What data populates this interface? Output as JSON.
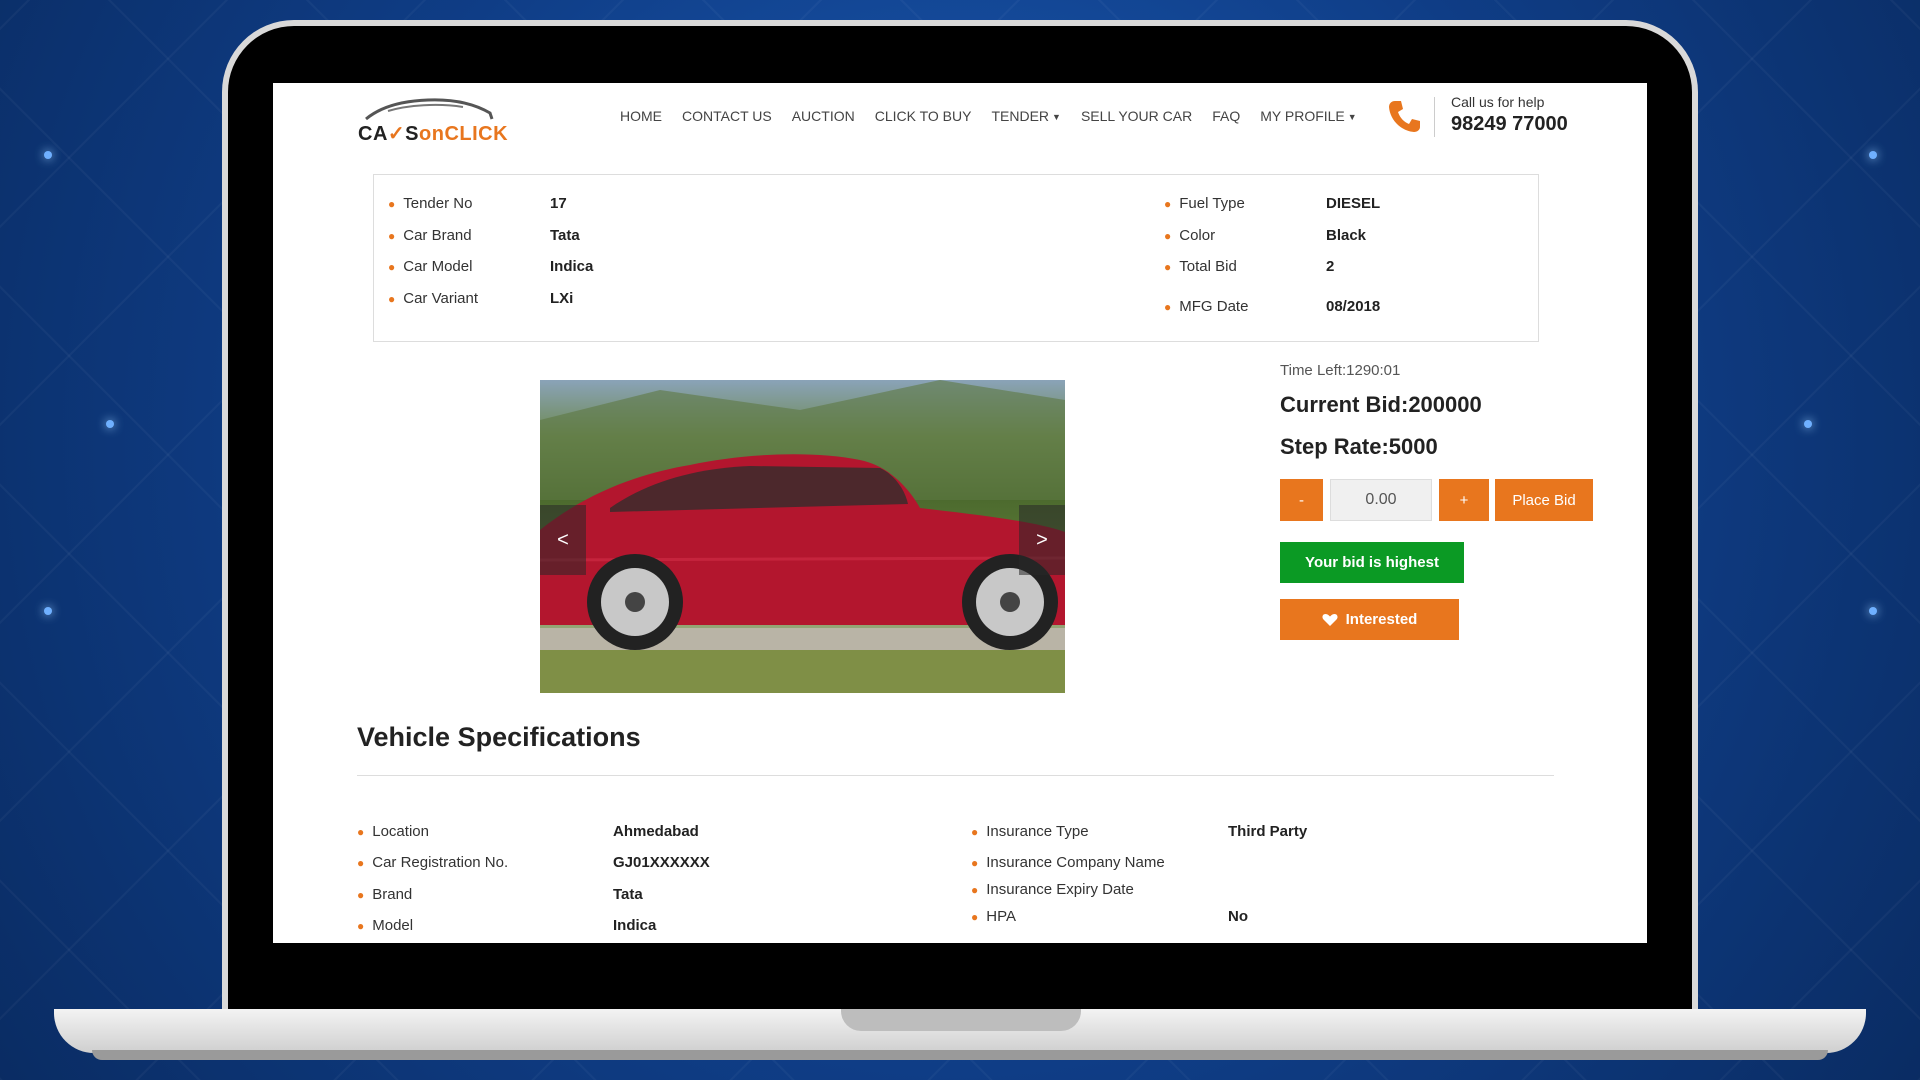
{
  "brand": {
    "logo_part1": "CA",
    "logo_part1b": "S",
    "logo_part2": "on",
    "logo_part3": "CLICK"
  },
  "nav": [
    {
      "label": "HOME",
      "dropdown": false
    },
    {
      "label": "CONTACT US",
      "dropdown": false
    },
    {
      "label": "AUCTION",
      "dropdown": false
    },
    {
      "label": "CLICK TO BUY",
      "dropdown": false
    },
    {
      "label": "TENDER",
      "dropdown": true
    },
    {
      "label": "SELL YOUR CAR",
      "dropdown": false
    },
    {
      "label": "FAQ",
      "dropdown": false
    },
    {
      "label": "MY PROFILE",
      "dropdown": true
    }
  ],
  "help": {
    "label": "Call us for help",
    "phone": "98249 77000"
  },
  "tender": {
    "left": [
      {
        "label": "Tender No",
        "value": "17"
      },
      {
        "label": "Car Brand",
        "value": "Tata"
      },
      {
        "label": "Car Model",
        "value": "Indica"
      },
      {
        "label": "Car Variant",
        "value": "LXi"
      }
    ],
    "right": [
      {
        "label": "Fuel Type",
        "value": "DIESEL"
      },
      {
        "label": "Color",
        "value": "Black"
      },
      {
        "label": "Total Bid",
        "value": "2"
      },
      {
        "label": "MFG Date",
        "value": "08/2018"
      }
    ]
  },
  "carousel": {
    "prev_label": "<",
    "next_label": ">"
  },
  "bid": {
    "time_left": "Time Left:1290:01",
    "current_bid": "Current Bid:200000",
    "step_rate": "Step Rate:5000",
    "minus_label": "-",
    "plus_label": "+",
    "input_value": "0.00",
    "place_bid_label": "Place Bid",
    "status_label": "Your bid is highest",
    "interested_label": "Interested"
  },
  "specs": {
    "title": "Vehicle Specifications",
    "left": [
      {
        "label": "Location",
        "value": "Ahmedabad"
      },
      {
        "label": "Car Registration No.",
        "value": "GJ01XXXXXX"
      },
      {
        "label": "Brand",
        "value": "Tata"
      },
      {
        "label": "Model",
        "value": "Indica"
      }
    ],
    "right": [
      {
        "label": "Insurance Type",
        "value": "Third Party"
      },
      {
        "label": "Insurance Company Name",
        "value": ""
      },
      {
        "label": "Insurance Expiry Date",
        "value": ""
      },
      {
        "label": "HPA",
        "value": "No"
      }
    ]
  },
  "colors": {
    "accent": "#e8761e",
    "success": "#0b9a24",
    "background": "#0e3a7c"
  }
}
